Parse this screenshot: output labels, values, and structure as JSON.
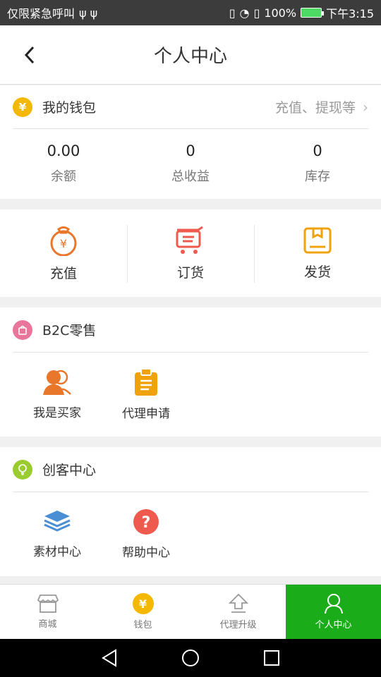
{
  "status_bar": {
    "left_text": "仅限紧急呼叫",
    "battery": "100%",
    "time": "下午3:15"
  },
  "header": {
    "title": "个人中心"
  },
  "wallet": {
    "title": "我的钱包",
    "coin_symbol": "¥",
    "link_text": "充值、提现等",
    "stats": [
      {
        "value": "0.00",
        "label": "余额"
      },
      {
        "value": "0",
        "label": "总收益"
      },
      {
        "value": "0",
        "label": "库存"
      }
    ]
  },
  "actions": [
    {
      "label": "充值"
    },
    {
      "label": "订货"
    },
    {
      "label": "发货"
    }
  ],
  "b2c": {
    "title": "B2C零售",
    "items": [
      {
        "label": "我是买家"
      },
      {
        "label": "代理申请"
      }
    ]
  },
  "maker": {
    "title": "创客中心",
    "items": [
      {
        "label": "素材中心"
      },
      {
        "label": "帮助中心"
      }
    ]
  },
  "tabbar": {
    "tabs": [
      {
        "label": "商城",
        "active": false
      },
      {
        "label": "钱包",
        "active": false
      },
      {
        "label": "代理升级",
        "active": false
      },
      {
        "label": "个人中心",
        "active": true
      }
    ]
  },
  "colors": {
    "accent_green": "#1aad19",
    "coin_yellow": "#f5b800",
    "orange": "#e8762b",
    "red": "#ee5a4d",
    "pink": "#e9759b",
    "lime": "#9acb2f",
    "blue": "#4a8fd4"
  }
}
